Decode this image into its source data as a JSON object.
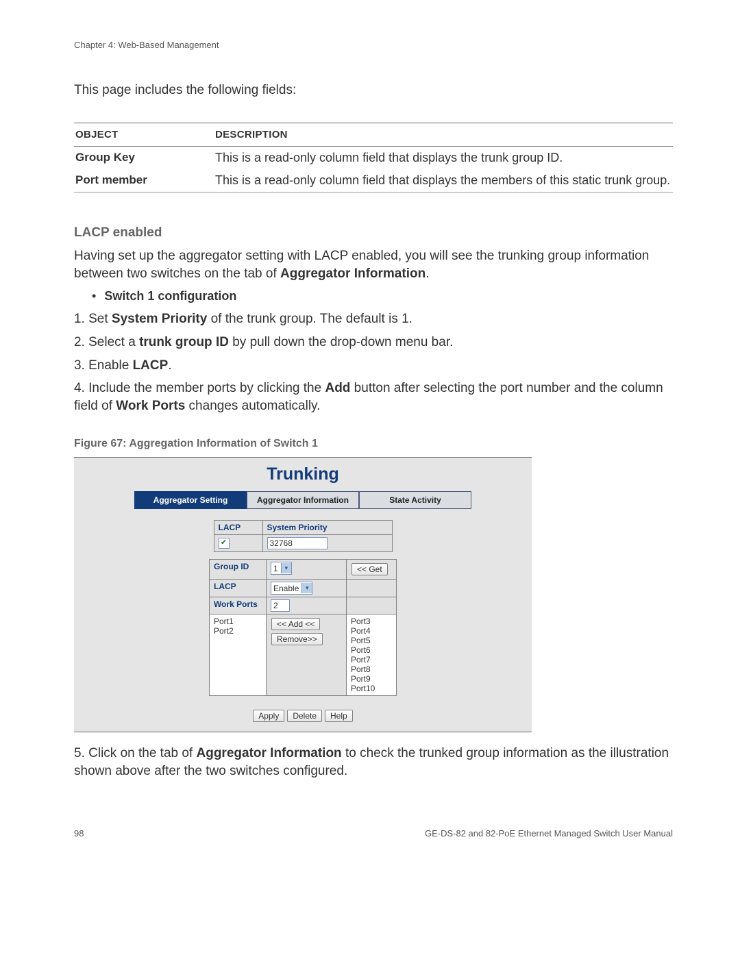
{
  "header": {
    "chapter": "Chapter 4: Web-Based Management"
  },
  "intro": "This page includes the following fields:",
  "table": {
    "headers": [
      "OBJECT",
      "DESCRIPTION"
    ],
    "rows": [
      {
        "object": "Group Key",
        "description": "This is a read-only column field that displays the trunk group ID."
      },
      {
        "object": "Port member",
        "description": "This is a read-only column field that displays the members of this static trunk group."
      }
    ]
  },
  "lacp": {
    "title": "LACP enabled",
    "para": "Having set up the aggregator setting with LACP enabled, you will see the trunking group information between two switches on the tab of ",
    "para_bold": "Aggregator Information",
    "para_end": ".",
    "bullet": "Switch 1 configuration",
    "steps": {
      "s1_a": "1. Set ",
      "s1_b": "System Priority",
      "s1_c": " of the trunk group. The default is 1.",
      "s2_a": "2. Select a ",
      "s2_b": "trunk group ID",
      "s2_c": " by pull down the drop-down menu bar.",
      "s3_a": "3. Enable ",
      "s3_b": "LACP",
      "s3_c": ".",
      "s4_a": "4. Include the member ports by clicking the ",
      "s4_b": "Add",
      "s4_c": " button after selecting the port number and the column field of ",
      "s4_d": "Work Ports",
      "s4_e": " changes automatically."
    }
  },
  "figure": {
    "caption": "Figure 67: Aggregation Information of Switch 1",
    "title": "Trunking",
    "tabs": [
      "Aggregator Setting",
      "Aggregator Information",
      "State Activity"
    ],
    "labels": {
      "lacp": "LACP",
      "system_priority": "System Priority",
      "group_id": "Group ID",
      "work_ports": "Work Ports"
    },
    "values": {
      "system_priority": "32768",
      "group_id": "1",
      "lacp_mode": "Enable",
      "work_ports_count": "2",
      "left_ports": [
        "Port1",
        "Port2"
      ],
      "right_ports": [
        "Port3",
        "Port4",
        "Port5",
        "Port6",
        "Port7",
        "Port8",
        "Port9",
        "Port10"
      ]
    },
    "buttons": {
      "get": "<< Get",
      "add": "<< Add <<",
      "remove": "Remove>>",
      "apply": "Apply",
      "delete": "Delete",
      "help": "Help"
    }
  },
  "after": {
    "a": "5. Click on the tab of ",
    "b": "Aggregator Information",
    "c": " to check the trunked group information as the illustration shown above after the two switches configured."
  },
  "footer": {
    "page": "98",
    "manual": "GE-DS-82 and 82-PoE Ethernet Managed Switch User Manual"
  }
}
